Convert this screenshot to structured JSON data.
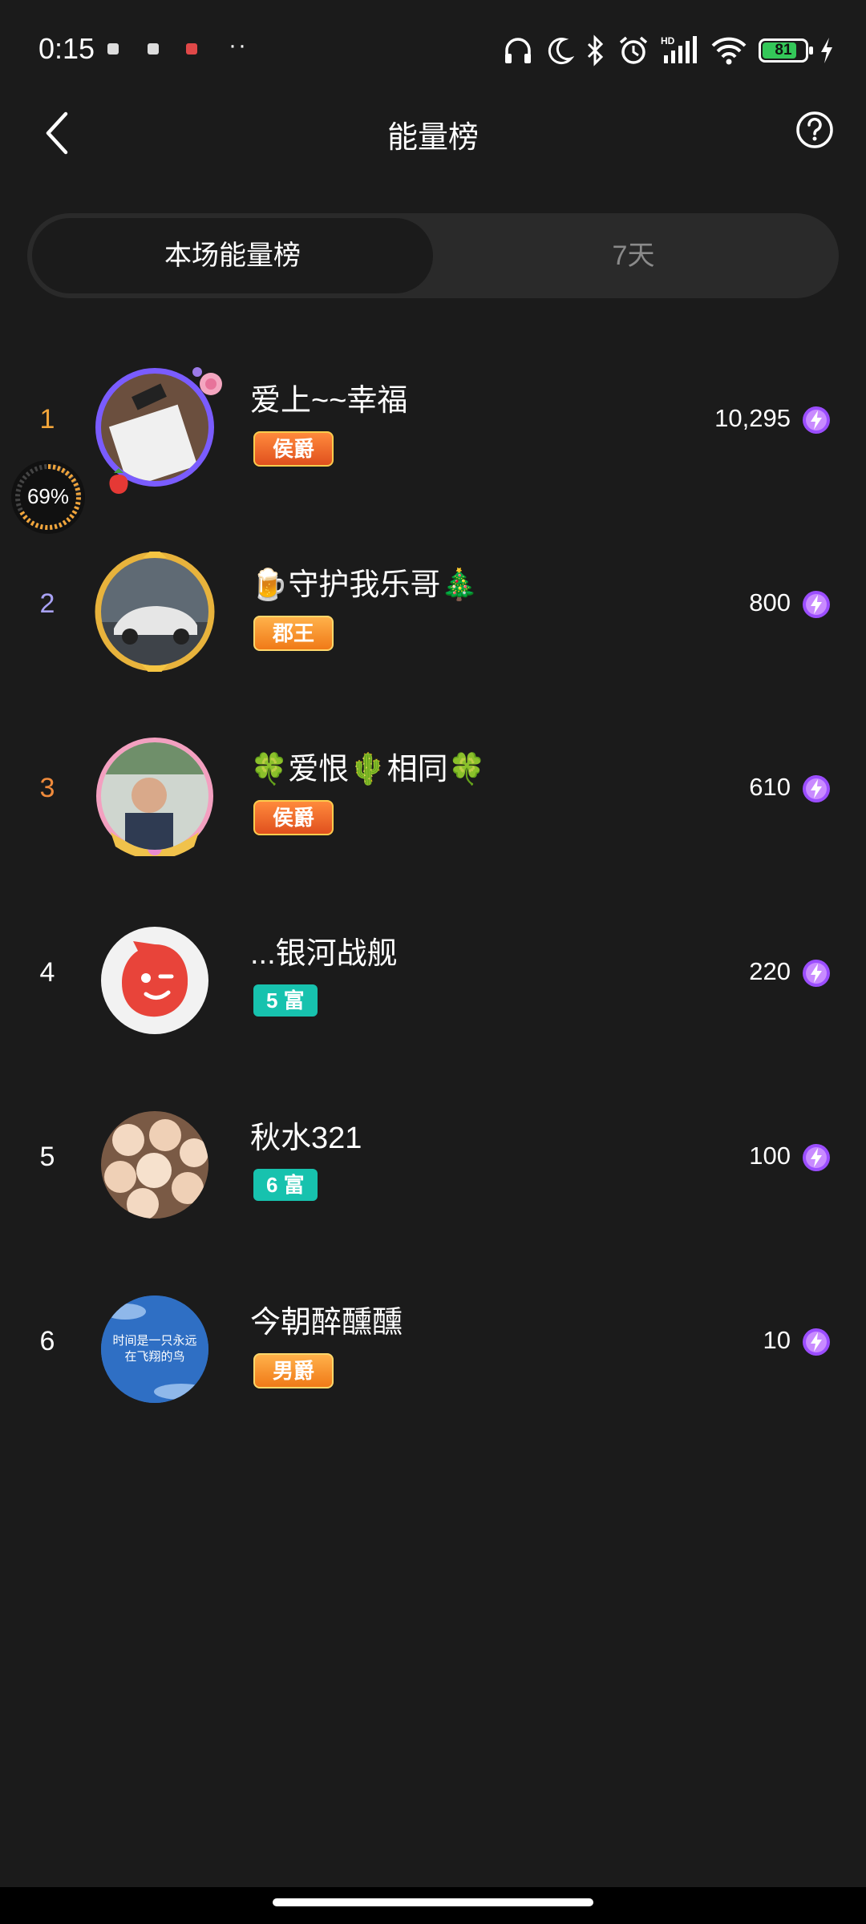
{
  "status_bar": {
    "time": "0:15",
    "dots": "··",
    "battery": "81",
    "battery_level": 0.81,
    "icons": [
      "headphones-icon",
      "moon-icon",
      "bluetooth-icon",
      "alarm-icon",
      "signal-icon",
      "wifi-icon",
      "battery-icon",
      "charging-icon"
    ]
  },
  "header": {
    "title": "能量榜",
    "back_icon": "chevron-left-icon",
    "help_icon": "question-circle-icon"
  },
  "tabs": [
    {
      "label": "本场能量榜",
      "active": true
    },
    {
      "label": "7天",
      "active": false
    }
  ],
  "progress": {
    "label": "69%",
    "value": 0.69
  },
  "rankings": [
    {
      "rank": "1",
      "rank_color": "#f2a53a",
      "name": "爱上~~幸福",
      "badge": "侯爵",
      "badge_style": "orange",
      "score": "10,295"
    },
    {
      "rank": "2",
      "rank_color": "#a9a2f5",
      "name": "🍺守护我乐哥🎄",
      "badge": "郡王",
      "badge_style": "gold",
      "score": "800"
    },
    {
      "rank": "3",
      "rank_color": "#f08b3c",
      "name": "🍀爱恨🌵相同🍀",
      "badge": "侯爵",
      "badge_style": "orange",
      "score": "610"
    },
    {
      "rank": "4",
      "rank_color": "#ffffff",
      "name": "...银河战舰",
      "badge": "5 富",
      "badge_style": "teal",
      "score": "220"
    },
    {
      "rank": "5",
      "rank_color": "#ffffff",
      "name": "秋水321",
      "badge": "6 富",
      "badge_style": "teal",
      "score": "100"
    },
    {
      "rank": "6",
      "rank_color": "#ffffff",
      "name": "今朝醉醺醺",
      "badge": "男爵",
      "badge_style": "gold",
      "score": "10"
    }
  ],
  "avatar6_text": "时间是一只永远在飞翔的鸟"
}
